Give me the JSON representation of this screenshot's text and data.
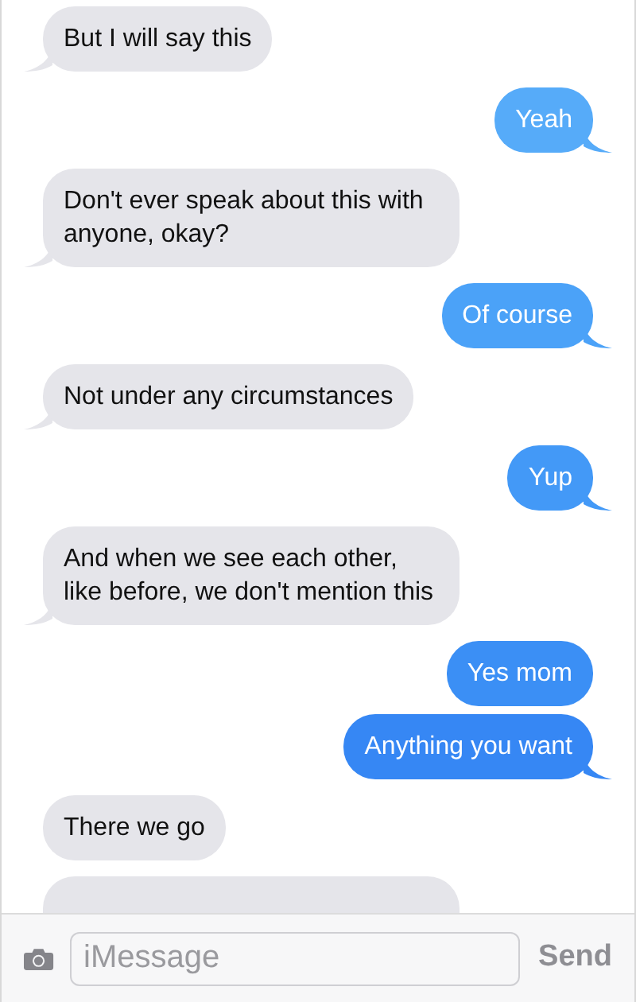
{
  "messages": [
    {
      "kind": "received",
      "text": "But I will say this",
      "tail": true
    },
    {
      "kind": "sent",
      "text": "Yeah",
      "tail": true,
      "color": "#56abf9"
    },
    {
      "kind": "received",
      "text": "Don't ever speak about this with anyone, okay?",
      "tail": true
    },
    {
      "kind": "sent",
      "text": "Of course",
      "tail": true,
      "color": "#4ba2f8"
    },
    {
      "kind": "received",
      "text": "Not under any circumstances",
      "tail": true
    },
    {
      "kind": "sent",
      "text": "Yup",
      "tail": true,
      "color": "#4399f7"
    },
    {
      "kind": "received",
      "text": "And when we see each other, like before, we don't mention this",
      "tail": true
    },
    {
      "kind": "sent",
      "text": "Yes mom",
      "tail": false,
      "color": "#3b8ff5"
    },
    {
      "kind": "sent",
      "text": "Anything you want",
      "tail": true,
      "color": "#3687f4"
    },
    {
      "kind": "received",
      "text": "There we go",
      "tail": false
    },
    {
      "kind": "covered"
    }
  ],
  "composer": {
    "placeholder": "iMessage",
    "send": "Send"
  }
}
